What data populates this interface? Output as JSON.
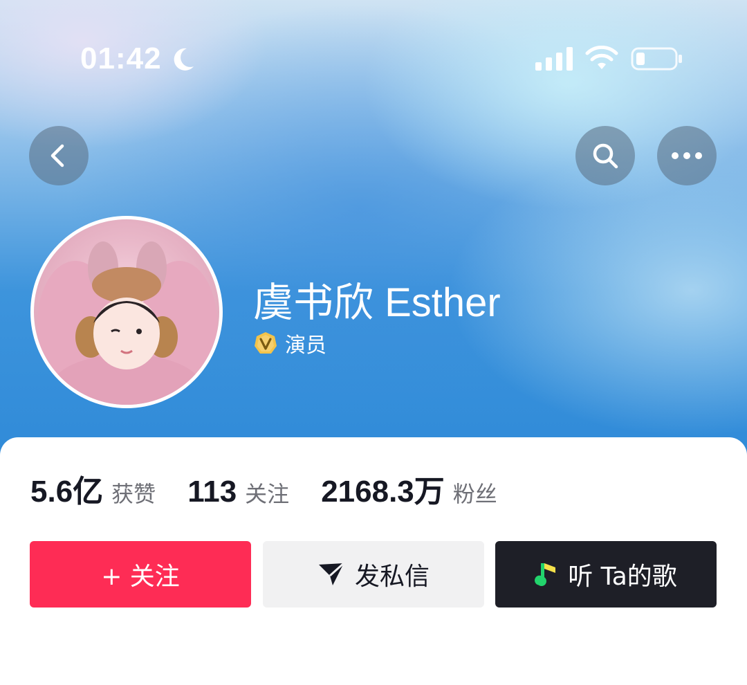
{
  "status_bar": {
    "time": "01:42",
    "icons": [
      "moon-icon",
      "signal-icon",
      "wifi-icon",
      "battery-icon"
    ]
  },
  "nav": {
    "icons": [
      "back-icon",
      "search-icon",
      "more-icon"
    ]
  },
  "profile": {
    "name": "虞书欣 Esther",
    "verify_label": "演员",
    "verify_icon": "verified-v-icon"
  },
  "stats": [
    {
      "value": "5.6亿",
      "label": "获赞"
    },
    {
      "value": "113",
      "label": "关注"
    },
    {
      "value": "2168.3万",
      "label": "粉丝"
    }
  ],
  "actions": {
    "follow": {
      "label": "+ 关注",
      "color": "#fe2c55"
    },
    "message": {
      "label": "发私信",
      "icon": "send-icon"
    },
    "music": {
      "label": "听 Ta的歌",
      "icon": "music-note-icon"
    }
  },
  "colors": {
    "accent": "#fe2c55",
    "text_primary": "#161823",
    "text_secondary": "#6e6f76",
    "dark_button": "#1e1f27",
    "light_button": "#f1f1f2"
  }
}
